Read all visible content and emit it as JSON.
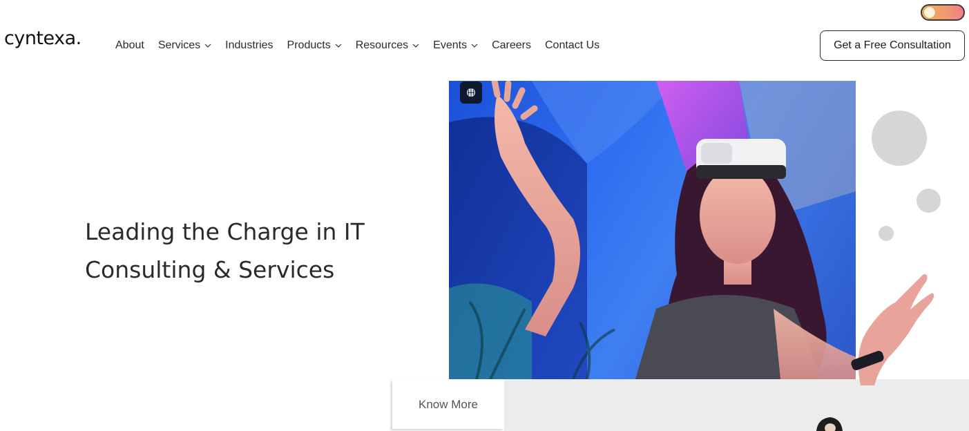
{
  "brand": {
    "logo_text": "cyntexa."
  },
  "theme_toggle": {
    "gradient_start": "#f2b15a",
    "gradient_end": "#ee7f87"
  },
  "nav": {
    "items": [
      {
        "label": "About",
        "dropdown": false
      },
      {
        "label": "Services",
        "dropdown": true
      },
      {
        "label": "Industries",
        "dropdown": false
      },
      {
        "label": "Products",
        "dropdown": true
      },
      {
        "label": "Resources",
        "dropdown": true
      },
      {
        "label": "Events",
        "dropdown": true
      },
      {
        "label": "Careers",
        "dropdown": false
      },
      {
        "label": "Contact Us",
        "dropdown": false
      }
    ],
    "cta_label": "Get a Free Consultation"
  },
  "hero": {
    "title_line1": "Leading the Charge in IT",
    "title_line2": "Consulting & Services",
    "image_icon": "brain-icon",
    "cta_label": "Know More"
  },
  "colors": {
    "image_blue": "#2f6ff0",
    "band_gray": "#ececec",
    "bubble_gray": "#d6d6d6"
  }
}
